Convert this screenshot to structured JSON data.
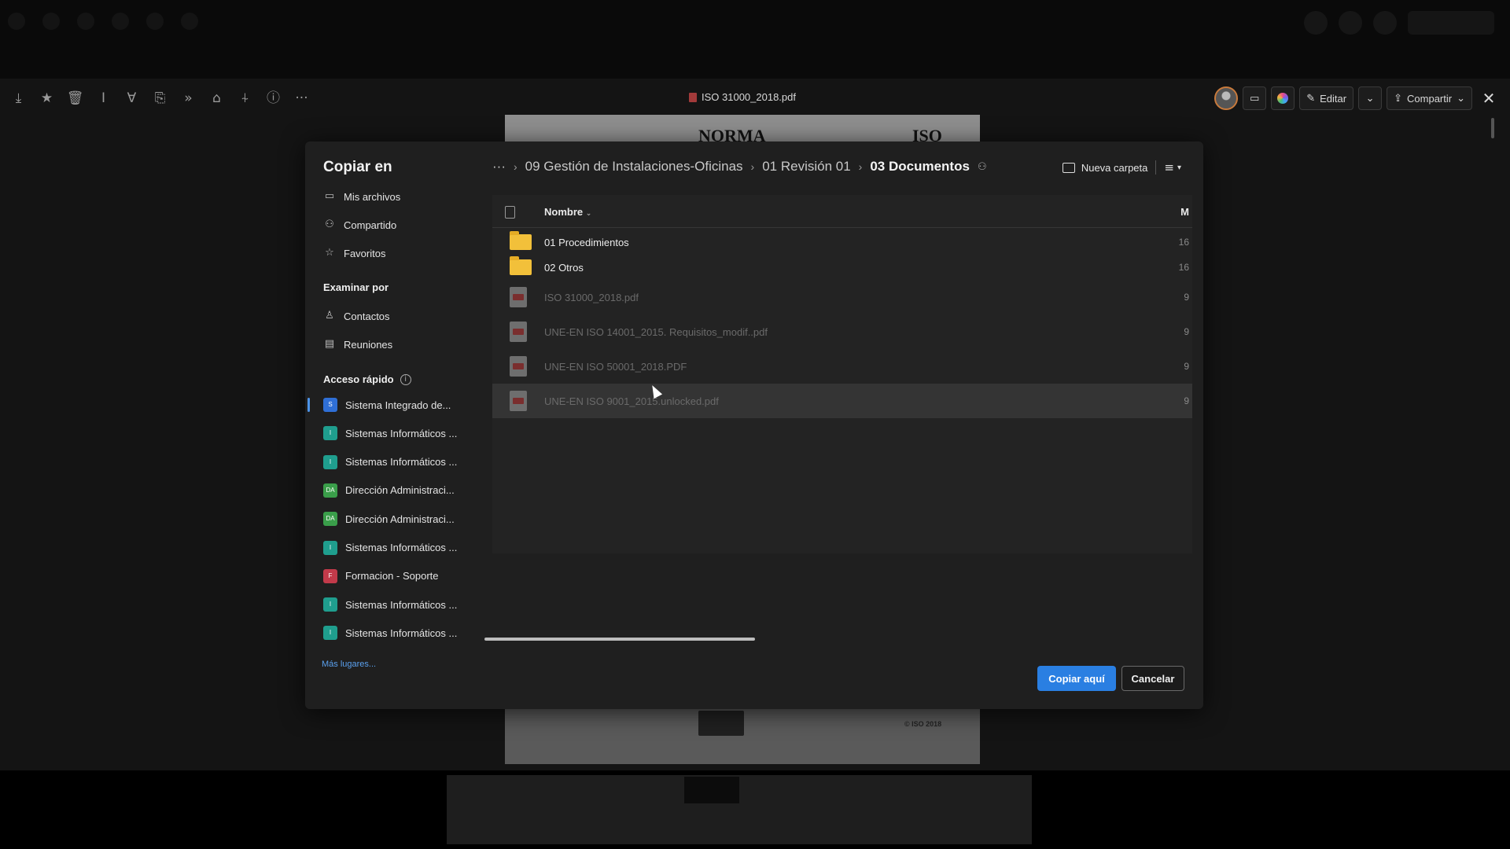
{
  "viewer": {
    "file_title": "ISO 31000_2018.pdf",
    "document_header_left": "NORMA",
    "document_header_right": "ISO",
    "document_copyright": "© ISO 2018",
    "toolbar_icons": [
      "download-icon",
      "star-icon",
      "trash-icon",
      "rename-icon",
      "filter-icon",
      "move-icon",
      "forward-icon",
      "lock-icon",
      "pin-icon",
      "info-icon",
      "more-icon"
    ],
    "actions": {
      "edit_label": "Editar",
      "share_label": "Compartir"
    }
  },
  "dialog": {
    "title": "Copiar en",
    "nav": [
      {
        "label": "Mis archivos",
        "icon": "folder-icon"
      },
      {
        "label": "Compartido",
        "icon": "people-icon"
      },
      {
        "label": "Favoritos",
        "icon": "star-icon"
      }
    ],
    "browse_header": "Examinar por",
    "browse": [
      {
        "label": "Contactos",
        "icon": "person-icon"
      },
      {
        "label": "Reuniones",
        "icon": "calendar-icon"
      }
    ],
    "quick_access_header": "Acceso rápido",
    "quick_access": [
      {
        "label": "Sistema Integrado de...",
        "badge": "S",
        "color": "#2f6fd6",
        "selected": true
      },
      {
        "label": "Sistemas Informáticos ...",
        "badge": "I",
        "color": "#1f9e8e",
        "selected": false
      },
      {
        "label": "Sistemas Informáticos ...",
        "badge": "I",
        "color": "#1f9e8e",
        "selected": false
      },
      {
        "label": "Dirección Administraci...",
        "badge": "DA",
        "color": "#3a9e4a",
        "selected": false
      },
      {
        "label": "Dirección Administraci...",
        "badge": "DA",
        "color": "#3a9e4a",
        "selected": false
      },
      {
        "label": "Sistemas Informáticos ...",
        "badge": "I",
        "color": "#1f9e8e",
        "selected": false
      },
      {
        "label": "Formacion - Soporte",
        "badge": "F",
        "color": "#c23a4a",
        "selected": false
      },
      {
        "label": "Sistemas Informáticos ...",
        "badge": "I",
        "color": "#1f9e8e",
        "selected": false
      },
      {
        "label": "Sistemas Informáticos ...",
        "badge": "I",
        "color": "#1f9e8e",
        "selected": false
      }
    ],
    "more_places": "Más lugares...",
    "breadcrumb": {
      "overflow": "···",
      "items": [
        "09 Gestión de Instalaciones-Oficinas",
        "01 Revisión 01"
      ],
      "current": "03 Documentos"
    },
    "new_folder_label": "Nueva carpeta",
    "columns": {
      "name": "Nombre",
      "modified": "M"
    },
    "rows": [
      {
        "type": "folder",
        "name": "01 Procedimientos",
        "modified": "16",
        "selected": false
      },
      {
        "type": "folder",
        "name": "02 Otros",
        "modified": "16",
        "selected": false
      },
      {
        "type": "file",
        "name": "ISO 31000_2018.pdf",
        "modified": "9",
        "selected": false
      },
      {
        "type": "file",
        "name": "UNE-EN ISO 14001_2015. Requisitos_modif..pdf",
        "modified": "9",
        "selected": false
      },
      {
        "type": "file",
        "name": "UNE-EN ISO 50001_2018.PDF",
        "modified": "9",
        "selected": false
      },
      {
        "type": "file",
        "name": "UNE-EN ISO 9001_2015.unlocked.pdf",
        "modified": "9",
        "selected": true
      }
    ],
    "primary_button": "Copiar aquí",
    "secondary_button": "Cancelar",
    "colors": {
      "accent": "#2a7fe2",
      "folder": "#f2c03a",
      "link": "#5aa0ee"
    }
  }
}
